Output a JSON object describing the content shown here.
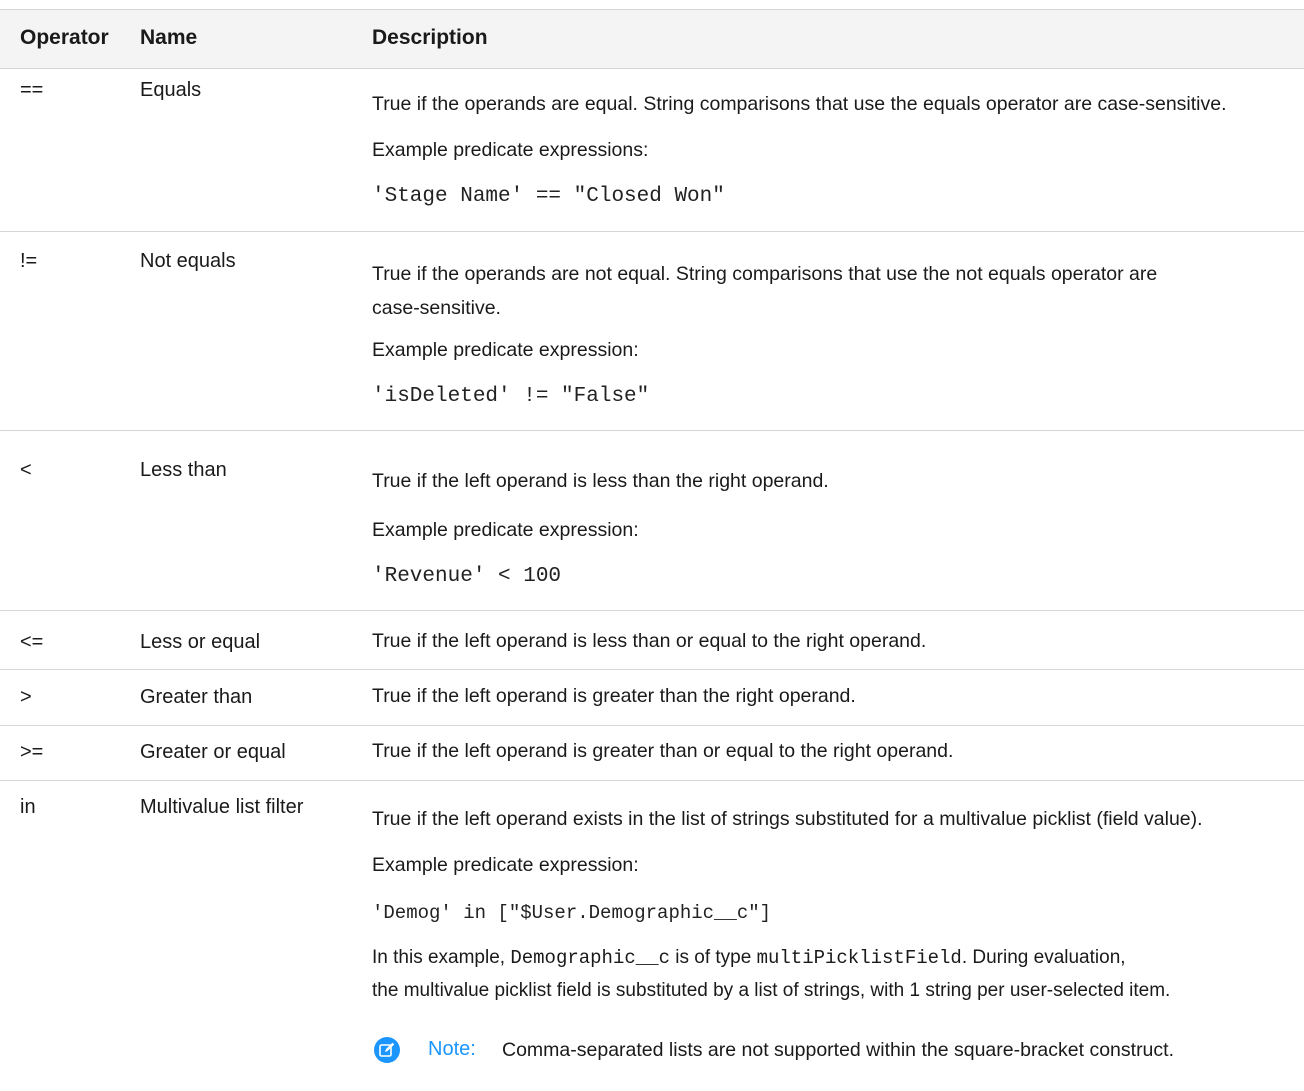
{
  "headers": {
    "operator": "Operator",
    "name": "Name",
    "description": "Description"
  },
  "rows": [
    {
      "operator": "==",
      "name": "Equals",
      "desc_line1": "True if the operands are equal. String comparisons that use the equals operator are case-sensitive.",
      "example_label": "Example predicate expressions:",
      "example_code": "'Stage Name' == \"Closed Won\""
    },
    {
      "operator": "!=",
      "name": "Not equals",
      "desc_line1": "True if the operands are not equal. String comparisons that use the not equals operator are",
      "desc_line2": "case-sensitive.",
      "example_label": "Example predicate expression:",
      "example_code": "'isDeleted' != \"False\""
    },
    {
      "operator": "<",
      "name": "Less than",
      "desc_line1": "True if the left operand is less than the right operand.",
      "example_label": "Example predicate expression:",
      "example_code": "'Revenue' < 100"
    },
    {
      "operator": "<=",
      "name": "Less or equal",
      "desc_line1": "True if the left operand is less than or equal to the right operand."
    },
    {
      "operator": ">",
      "name": "Greater than",
      "desc_line1": "True if the left operand is greater than the right operand."
    },
    {
      "operator": ">=",
      "name": "Greater or equal",
      "desc_line1": "True if the left operand is greater than or equal to the right operand."
    },
    {
      "operator": "in",
      "name": "Multivalue list filter",
      "desc_line1": "True if the left operand exists in the list of strings substituted for a multivalue picklist (field value).",
      "example_label": "Example predicate expression:",
      "example_code": "'Demog' in [\"$User.Demographic__c\"]",
      "explain_prefix": "In this example, ",
      "explain_code1": "Demographic__c",
      "explain_mid": " is of type ",
      "explain_code2": "multiPicklistField",
      "explain_suffix": ". During evaluation,",
      "explain_line2": "the multivalue picklist field is substituted by a list of strings, with 1 string per user-selected item.",
      "note_label": "Note:",
      "note_text": "Comma-separated lists are not supported within the square-bracket construct."
    }
  ],
  "colors": {
    "note_accent": "#1b96ff",
    "header_bg": "#f4f4f4",
    "border": "#d6d6d6"
  },
  "icons": {
    "note": "edit-note-icon"
  }
}
